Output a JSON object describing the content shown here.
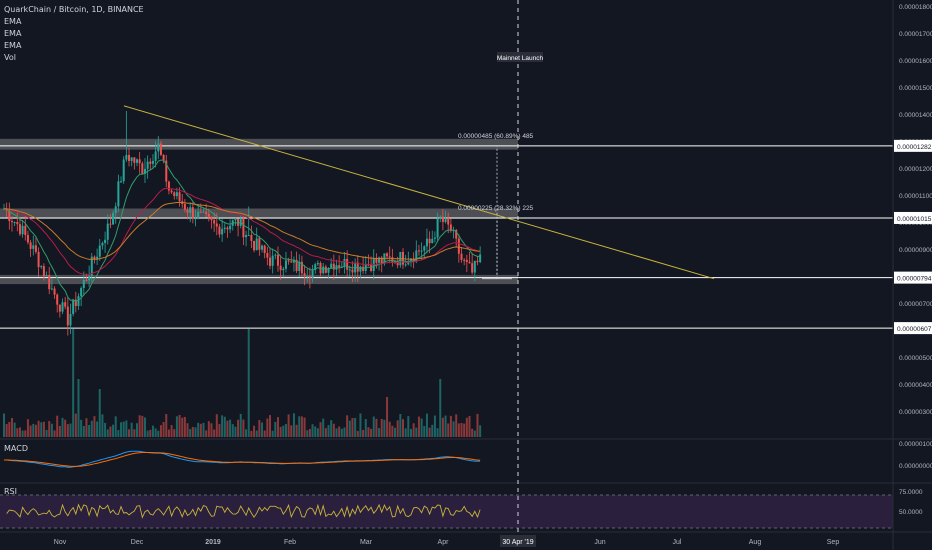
{
  "legend": {
    "title": "QuarkChain / Bitcoin, 1D, BINANCE",
    "lines": [
      "EMA",
      "EMA",
      "EMA",
      "Vol"
    ]
  },
  "indicators": {
    "macd_label": "MACD",
    "rsi_label": "RSI"
  },
  "colors": {
    "background": "#131722",
    "up": "#26a69a",
    "down": "#ef5350",
    "trendline": "#c8b43c",
    "ema_fast": "#2e9e6e",
    "ema_mid": "#b71c4a",
    "ema_slow": "#c87a2a",
    "macd_line": "#2196f3",
    "signal_line": "#ff6d00",
    "rsi_line": "#c8b43c",
    "rsi_band": "#2a1f3d",
    "zone": "#7d7d7d"
  },
  "chart_data": [
    {
      "type": "candlestick",
      "title": "QuarkChain / Bitcoin, 1D, BINANCE",
      "y_scale": "price",
      "ylim": [
        6.1e-06,
        1.81e-05
      ],
      "y_ticks": [
        "0.00001800",
        "0.00001700",
        "0.00001600",
        "0.00001500",
        "0.00001400",
        "0.00001300",
        "0.00001200",
        "0.00001100",
        "0.00001000",
        "0.00000900",
        "0.00000800",
        "0.00000700",
        "0.00000600",
        "0.00000500",
        "0.00000400",
        "0.00000300"
      ],
      "x_ticks": [
        "Nov",
        "Dec",
        "2019",
        "Feb",
        "Mar",
        "Apr",
        "30 Apr '19",
        "Jun",
        "Jul",
        "Aug",
        "Sep"
      ],
      "price_levels": [
        {
          "label": "0.00001282",
          "value": 1.282e-05
        },
        {
          "label": "0.00001015",
          "value": 1.015e-05
        },
        {
          "label": "0.00000794",
          "value": 7.94e-06
        },
        {
          "label": "0.00000607",
          "value": 6.07e-06
        }
      ],
      "zones": [
        {
          "from": 1.268e-05,
          "to": 1.308e-05
        },
        {
          "from": 1.012e-05,
          "to": 1.05e-05
        },
        {
          "from": 7.7e-06,
          "to": 8.04e-06
        }
      ],
      "annotations": [
        {
          "text": "0.00000485 (60.89%) 485"
        },
        {
          "text": "0.00000225 (28.32%) 225"
        },
        {
          "text": "Mainnet Launch"
        }
      ],
      "trendline": {
        "from_date": "2018-11-27",
        "from_price": 1.43e-05,
        "to_date": "2019-07-20",
        "to_price": 7.9e-06
      },
      "event_date": "30 Apr '19"
    },
    {
      "type": "line",
      "title": "MACD",
      "y_ticks": [
        "0.00000100",
        "0.00000000"
      ]
    },
    {
      "type": "line",
      "title": "RSI",
      "y_ticks": [
        "75.0000",
        "50.0000"
      ],
      "levels": [
        70,
        30
      ]
    }
  ]
}
